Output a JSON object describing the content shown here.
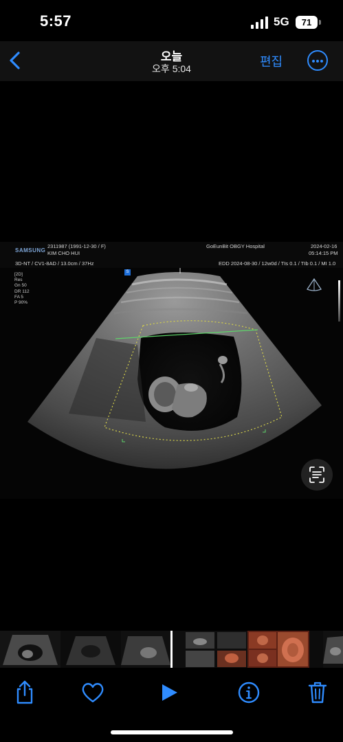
{
  "status": {
    "time": "5:57",
    "network": "5G",
    "battery": "71"
  },
  "nav": {
    "title": "오늘",
    "subtitle": "오후 5:04",
    "edit_label": "편집",
    "icons": {
      "back": "chevron-left-icon",
      "more": "ellipsis-circle-icon"
    }
  },
  "ultrasound": {
    "brand": "SAMSUNG",
    "patient_id": "2311987 (1991-12-30 / F)",
    "patient_name": "KIM CHO HUI",
    "hospital": "GoEunBit OBGY Hospital",
    "date": "2024-02-16",
    "time": "05:14:15 PM",
    "probe_info": "3D-NT / CV1-8AD / 13.0cm / 37Hz",
    "edd_info": "EDD 2024-08-30 / 12w0d / TIs  0.1 / TIb  0.1 / MI  1.0",
    "params": [
      "[2D]",
      "Res",
      "Gn   50",
      "DR   112",
      "FA   5",
      "P    90%"
    ],
    "marker": "S"
  },
  "toolbar": {
    "icons": [
      "share-icon",
      "heart-icon",
      "play-icon",
      "info-icon",
      "trash-icon"
    ]
  },
  "colors": {
    "accent": "#2f8cff",
    "nav_bg": "#121212",
    "roi_yellow": "#d6d24a",
    "roi_green": "#5fd46a"
  }
}
